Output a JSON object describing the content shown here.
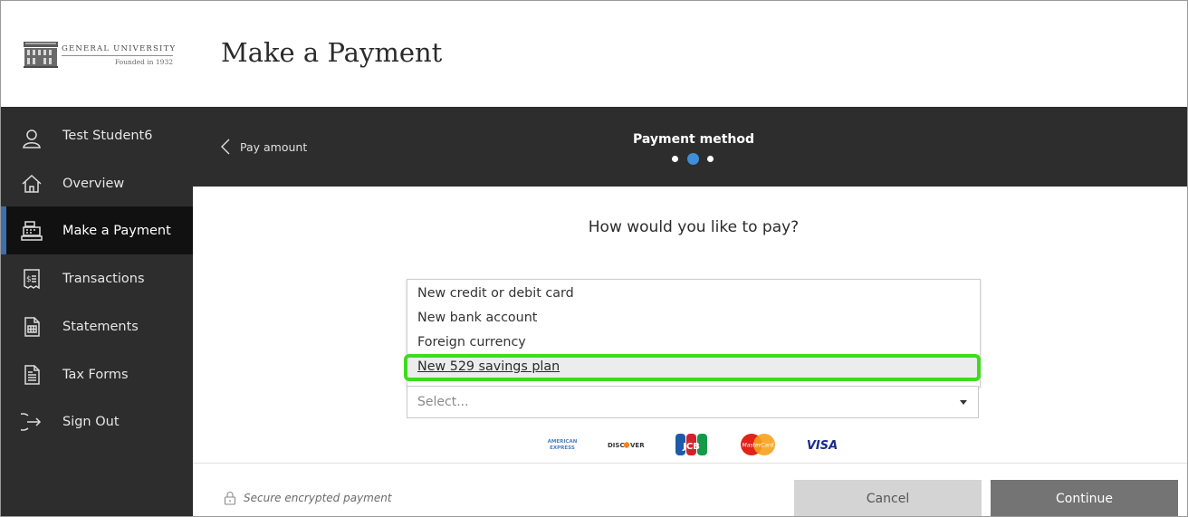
{
  "logo": {
    "name": "GENERAL UNIVERSITY",
    "founded": "Founded in 1932"
  },
  "header": {
    "title": "Make a Payment"
  },
  "sidebar": {
    "items": [
      {
        "label": "Test Student6",
        "icon": "user-icon"
      },
      {
        "label": "Overview",
        "icon": "home-icon"
      },
      {
        "label": "Make a Payment",
        "icon": "cash-register-icon",
        "active": true
      },
      {
        "label": "Transactions",
        "icon": "receipt-icon"
      },
      {
        "label": "Statements",
        "icon": "statement-icon"
      },
      {
        "label": "Tax Forms",
        "icon": "tax-form-icon"
      },
      {
        "label": "Sign Out",
        "icon": "sign-out-icon"
      }
    ]
  },
  "stepbar": {
    "back_label": "Pay amount",
    "title": "Payment method",
    "steps_total": 3,
    "current_step": 2
  },
  "main": {
    "question": "How would you like to pay?",
    "options": [
      "New credit or debit card",
      "New bank account",
      "Foreign currency",
      "New 529 savings plan"
    ],
    "highlighted_option": "New 529 savings plan",
    "select_placeholder": "Select..."
  },
  "cards": {
    "amex": "AMERICAN EXPRESS",
    "discover": "DISCOVER",
    "jcb": "JCB",
    "mastercard": "MasterCard",
    "visa": "VISA"
  },
  "footer": {
    "secure_text": "Secure encrypted payment",
    "cancel_label": "Cancel",
    "continue_label": "Continue"
  },
  "colors": {
    "sidebar_bg": "#2d2d2d",
    "active_accent": "#3e6fa8",
    "step_dot_active": "#3f8ed9",
    "highlight_border": "#3ddc1d",
    "continue_bg": "#747474",
    "cancel_bg": "#d4d4d4"
  }
}
